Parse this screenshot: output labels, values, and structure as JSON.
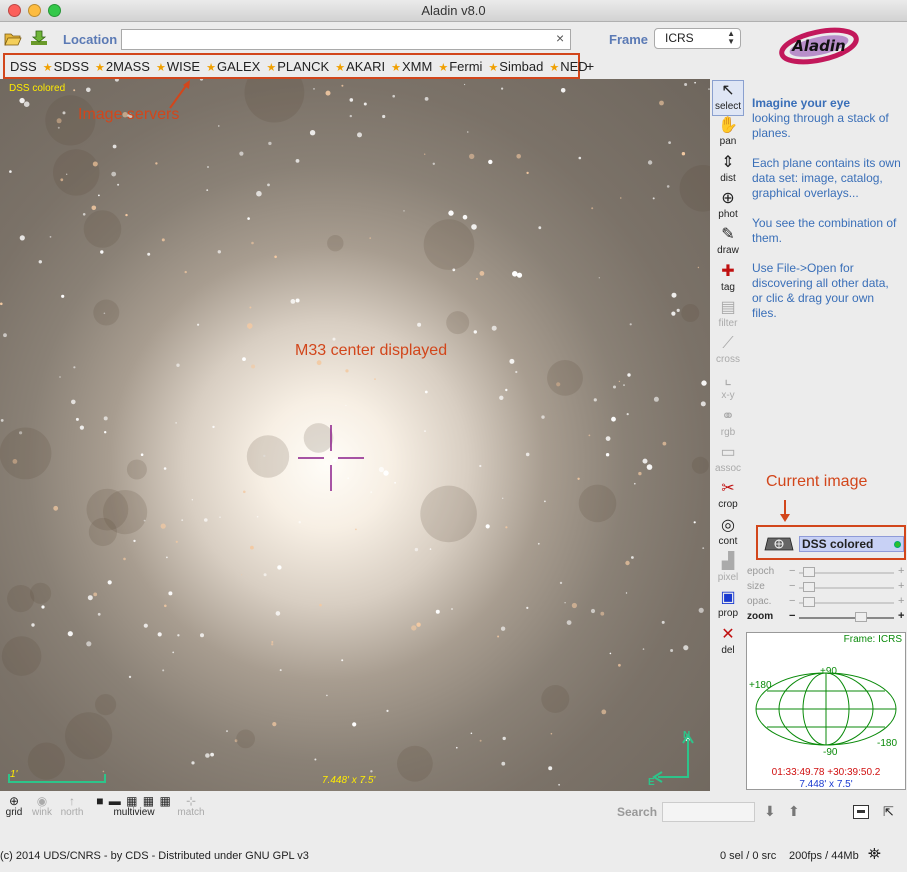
{
  "window": {
    "title": "Aladin v8.0"
  },
  "toolbar": {
    "open_icon": "folder-open-icon",
    "load_icon": "download-icon",
    "location_label": "Location",
    "location_value": "",
    "clear_icon": "×",
    "frame_label": "Frame",
    "frame_value": "ICRS"
  },
  "logo": {
    "text": "Aladin"
  },
  "servers": {
    "items": [
      "DSS",
      "SDSS",
      "2MASS",
      "WISE",
      "GALEX",
      "PLANCK",
      "AKARI",
      "XMM",
      "Fermi",
      "Simbad",
      "NED"
    ],
    "add_label": "+"
  },
  "view": {
    "plane_label": "DSS colored",
    "annotation_servers": "Image servers",
    "annotation_center": "M33 center displayed",
    "scale_label": "1'",
    "size_label": "7.448' x 7.5'",
    "compass_n": "N",
    "compass_e": "E"
  },
  "tools": [
    {
      "label": "select",
      "icon": "arrow-cursor-icon",
      "enabled": true
    },
    {
      "label": "pan",
      "icon": "hand-icon",
      "enabled": true
    },
    {
      "label": "dist",
      "icon": "distance-icon",
      "enabled": true
    },
    {
      "label": "phot",
      "icon": "photometry-icon",
      "enabled": true
    },
    {
      "label": "draw",
      "icon": "pencil-icon",
      "enabled": true
    },
    {
      "label": "tag",
      "icon": "tag-icon",
      "enabled": true
    },
    {
      "label": "filter",
      "icon": "filter-icon",
      "enabled": false
    },
    {
      "label": "cross",
      "icon": "cross-icon",
      "enabled": false
    },
    {
      "label": "x-y",
      "icon": "xy-plot-icon",
      "enabled": false
    },
    {
      "label": "rgb",
      "icon": "rgb-icon",
      "enabled": false
    },
    {
      "label": "assoc",
      "icon": "assoc-icon",
      "enabled": false
    },
    {
      "label": "crop",
      "icon": "scissors-icon",
      "enabled": true
    },
    {
      "label": "cont",
      "icon": "contour-icon",
      "enabled": true
    },
    {
      "label": "pixel",
      "icon": "pixel-icon",
      "enabled": false
    },
    {
      "label": "prop",
      "icon": "properties-icon",
      "enabled": true
    },
    {
      "label": "del",
      "icon": "delete-icon",
      "enabled": true
    }
  ],
  "help": {
    "p1_title": "Imagine your eye",
    "p1_text": "looking through a stack of planes.",
    "p2": "Each plane contains its own data set: image, catalog, graphical overlays...",
    "p3": "You see the combination of them.",
    "p4": "Use File->Open for discovering all other data,\nor clic & drag your own files."
  },
  "stack": {
    "annotation": "Current image",
    "plane_name": "DSS colored",
    "status_color": "#2bc02b"
  },
  "sliders": [
    {
      "label": "epoch",
      "enabled": false,
      "level": 0.05
    },
    {
      "label": "size",
      "enabled": false,
      "level": 0.05
    },
    {
      "label": "opac.",
      "enabled": false,
      "level": 0.05
    },
    {
      "label": "zoom",
      "enabled": true,
      "level": 0.68
    }
  ],
  "minimap": {
    "frame_label": "Frame: ICRS",
    "lat_top": "+90",
    "lat_bottom": "-90",
    "lon_left": "+180",
    "lon_right": "-180",
    "coord": "01:33:49.78 +30:39:50.2",
    "fov": "7.448' x 7.5'"
  },
  "bottom": {
    "grid": "grid",
    "wink": "wink",
    "north": "north",
    "multiview": "multiview",
    "match": "match",
    "search_label": "Search",
    "search_value": ""
  },
  "status": {
    "copyright": "(c) 2014 UDS/CNRS - by CDS - Distributed under GNU GPL v3",
    "selection": "0 sel / 0 src",
    "perf": "200fps / 44Mb"
  },
  "colors": {
    "accent_blue": "#5b7ab5",
    "highlight_orange": "#d2461b",
    "help_blue": "#3a6fb8",
    "grid_green": "#0a8a0a",
    "coord_red": "#d01010"
  }
}
